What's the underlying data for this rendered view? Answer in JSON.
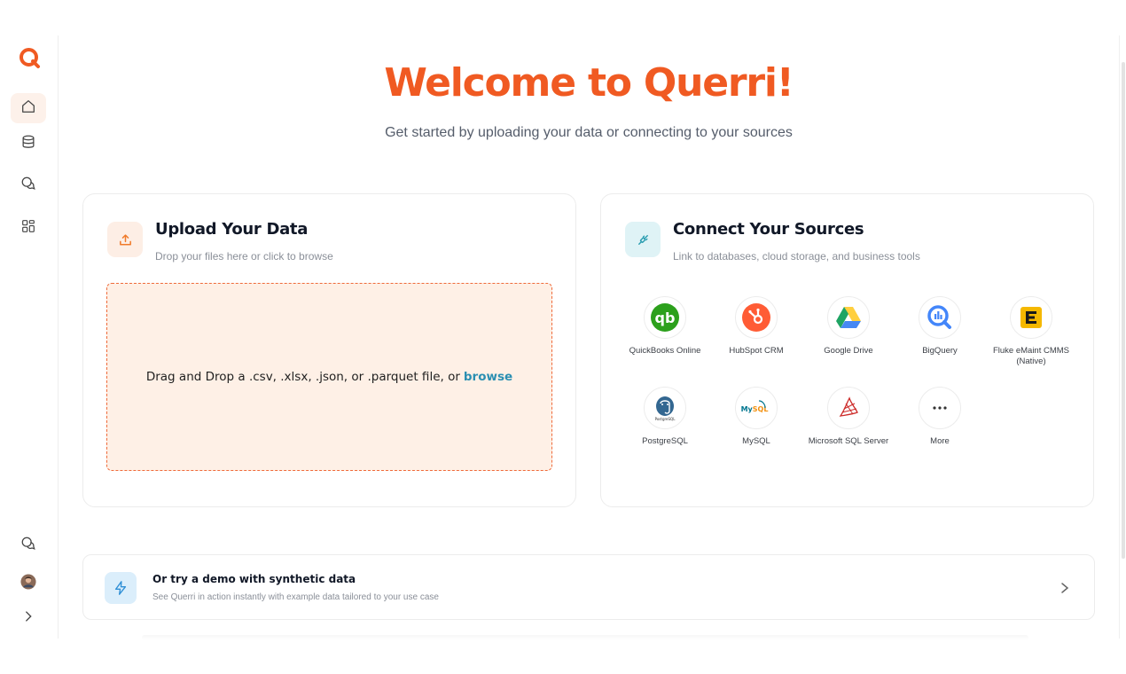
{
  "header": {
    "title": "Welcome to Querri!",
    "subtitle": "Get started by uploading your data or connecting to your sources"
  },
  "sidebar": {
    "logo_icon": "querri-logo-icon",
    "items": [
      {
        "icon": "home-icon",
        "active": true
      },
      {
        "icon": "database-icon",
        "active": false
      },
      {
        "icon": "chat-icon",
        "active": false
      },
      {
        "icon": "dashboard-icon",
        "active": false
      }
    ],
    "bottom": [
      {
        "icon": "chat-icon"
      },
      {
        "icon": "avatar"
      },
      {
        "icon": "chevron-right-icon"
      }
    ]
  },
  "upload": {
    "icon": "upload-icon",
    "title": "Upload Your Data",
    "subtitle": "Drop your files here or click to browse",
    "drop_text": "Drag and Drop a .csv, .xlsx, .json, or .parquet file, or",
    "browse_label": "browse"
  },
  "connect": {
    "icon": "plug-icon",
    "title": "Connect Your Sources",
    "subtitle": "Link to databases, cloud storage, and business tools",
    "connectors": [
      {
        "label": "QuickBooks Online",
        "icon": "quickbooks-icon",
        "color": "#2ca01c"
      },
      {
        "label": "HubSpot CRM",
        "icon": "hubspot-icon",
        "color": "#ff5c35"
      },
      {
        "label": "Google Drive",
        "icon": "google-drive-icon",
        "color": "#1fa463"
      },
      {
        "label": "BigQuery",
        "icon": "bigquery-icon",
        "color": "#4386fa"
      },
      {
        "label": "Fluke eMaint CMMS (Native)",
        "icon": "emaint-icon",
        "color": "#f5b800"
      },
      {
        "label": "PostgreSQL",
        "icon": "postgresql-icon",
        "color": "#336791"
      },
      {
        "label": "MySQL",
        "icon": "mysql-icon",
        "color": "#00758f"
      },
      {
        "label": "Microsoft SQL Server",
        "icon": "sql-server-icon",
        "color": "#cc2927"
      },
      {
        "label": "More",
        "icon": "more-icon",
        "color": "#333333"
      }
    ]
  },
  "demo": {
    "icon": "lightning-icon",
    "title": "Or try a demo with synthetic data",
    "subtitle": "See Querri in action instantly with example data tailored to your use case"
  },
  "colors": {
    "accent": "#f05a22",
    "link": "#2b8fb2"
  }
}
